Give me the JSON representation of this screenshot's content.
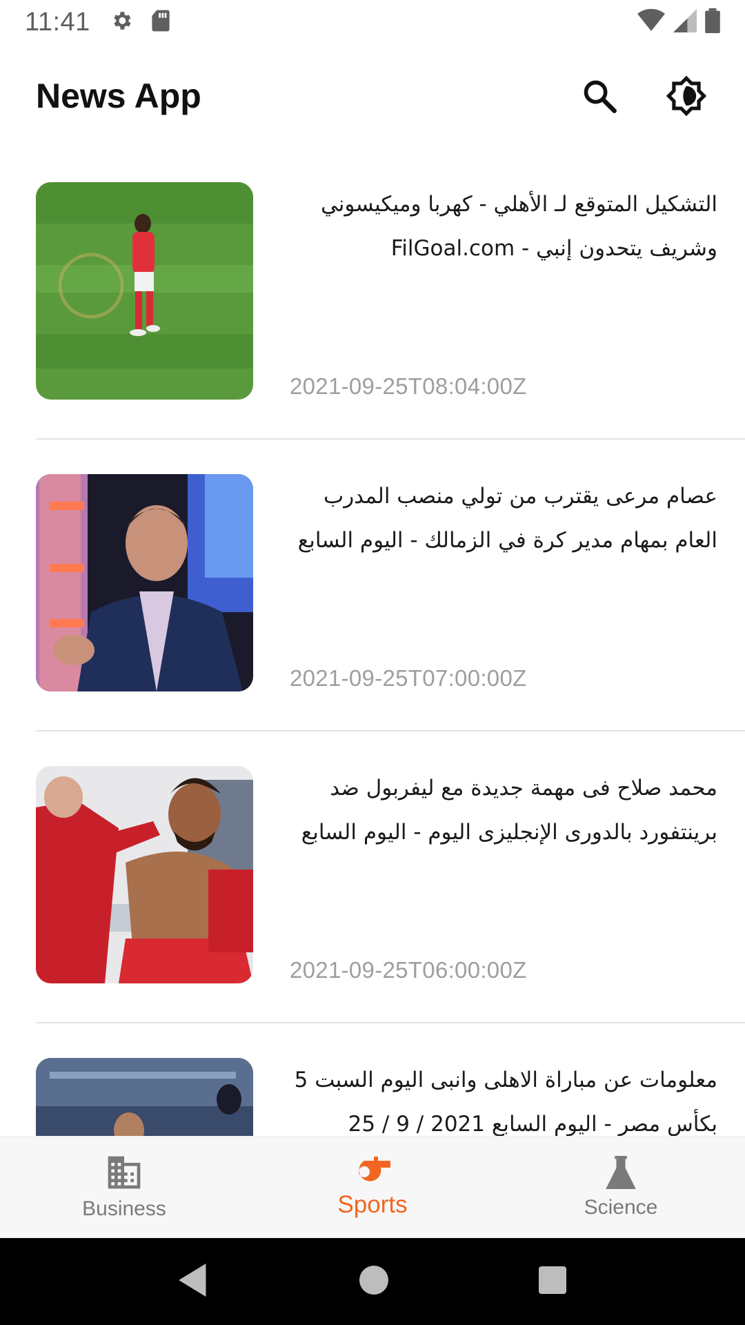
{
  "status_bar": {
    "time": "11:41",
    "icons": [
      "settings-icon",
      "sd-card-icon",
      "wifi-icon",
      "signal-icon",
      "battery-icon"
    ]
  },
  "app_bar": {
    "title": "News App",
    "actions": [
      "search-icon",
      "brightness-icon"
    ]
  },
  "articles": [
    {
      "title": "التشكيل المتوقع لـ الأهلي - كهربا وميكيسوني وشريف يتحدون إنبي - FilGoal.com",
      "date": "2021-09-25T08:04:00Z"
    },
    {
      "title": "عصام مرعى يقترب من تولي منصب المدرب العام بمهام مدير كرة في الزمالك - اليوم السابع",
      "date": "2021-09-25T07:00:00Z"
    },
    {
      "title": "محمد صلاح فى مهمة جديدة مع ليفربول ضد برينتفورد بالدورى الإنجليزى اليوم - اليوم السابع",
      "date": "2021-09-25T06:00:00Z"
    },
    {
      "title": "معلومات عن مباراة الاهلى وانبى اليوم السبت 5 بكأس مصر - اليوم السابع 2021 / 9 / 25",
      "date": ""
    }
  ],
  "bottom_nav": {
    "items": [
      {
        "label": "Business",
        "icon": "building-icon",
        "active": false
      },
      {
        "label": "Sports",
        "icon": "whistle-icon",
        "active": true
      },
      {
        "label": "Science",
        "icon": "flask-icon",
        "active": false
      }
    ]
  },
  "colors": {
    "accent": "#f26522",
    "inactive": "#7a7a7a",
    "date": "#9e9e9e",
    "divider": "#e2e2e2"
  },
  "system_nav": [
    "back-icon",
    "home-icon",
    "recents-icon"
  ]
}
